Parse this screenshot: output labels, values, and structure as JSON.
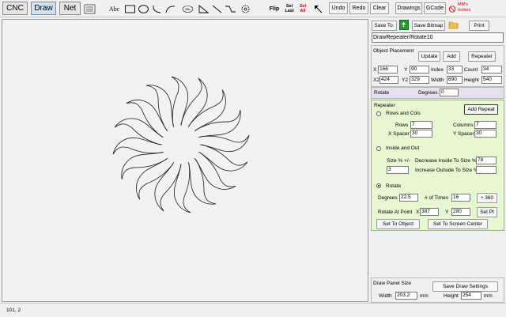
{
  "tabs": [
    {
      "label": "CNC"
    },
    {
      "label": "Draw"
    },
    {
      "label": "Net"
    }
  ],
  "tools": {
    "text": "Abc",
    "circle_text": "Abc",
    "flip": "Flip",
    "sel_last": "Sel\nLast",
    "sel_all": "Sel\nAll",
    "undo": "Undo",
    "redo": "Redo",
    "clear": "Clear",
    "drawings": "Drawings",
    "gcode": "GCode",
    "units": "MM's\nInches"
  },
  "panel": {
    "save_to": "Save To:",
    "save_bitmap": "Save Bitmap",
    "print": "Print",
    "filename": "DrawRepeater/Rotate10",
    "object_placement": {
      "title": "Object Placement",
      "update": "Update",
      "add": "Add",
      "repeater": "Repeater",
      "x_label": "X",
      "x_value": "166",
      "y_label": "Y",
      "y_value": "90",
      "index_label": "Index",
      "index_value": "33",
      "count_label": "Count",
      "count_value": "34",
      "x2_label": "X2",
      "x2_value": "424",
      "y2_label": "Y2",
      "y2_value": "329",
      "width_label": "Width",
      "width_value": "690",
      "height_label": "Height",
      "height_value": "540"
    },
    "rotate_row": {
      "label": "Rotate",
      "degrees_label": "Degrees",
      "degrees_value": "0"
    },
    "repeater": {
      "title": "Repeater",
      "add_repeat": "Add Repeat",
      "rows_cols": "Rows and Cols",
      "rows_label": "Rows",
      "rows_value": "7",
      "columns_label": "Columns",
      "columns_value": "7",
      "xspacer_label": "X Spacer",
      "xspacer_value": "30",
      "yspacer_label": "Y Spacer",
      "yspacer_value": "30",
      "inside_out": "Inside and Out",
      "size_label": "Size % +/-",
      "size_value": "3",
      "decrease_label": "Decrease Inside To Size %",
      "decrease_value": "78",
      "increase_label": "Increase Outside To Size %",
      "increase_value": "",
      "rotate": "Rotate",
      "degrees_label": "Degrees",
      "degrees_value": "22.5",
      "times_label": "# of Times",
      "times_value": "16",
      "div360": "÷ 360",
      "rotate_point_label": "Rotate At Point",
      "rp_x_label": "X",
      "rp_x_value": "387",
      "rp_y_label": "Y",
      "rp_y_value": "280",
      "set_pt": "Set Pt",
      "set_to_object": "Set To Object",
      "set_to_center": "Set To Screen Center"
    },
    "draw_panel": {
      "title": "Draw Panel Size",
      "save_settings": "Save Draw Settings",
      "width_label": "Width",
      "width_value": "203.2",
      "width_unit": "mm",
      "height_label": "Height",
      "height_value": "254",
      "height_unit": "mm"
    }
  },
  "status": {
    "coords": "101, 2"
  },
  "drawing": {
    "petal_count": 16,
    "rotation_degrees": 22.5
  }
}
